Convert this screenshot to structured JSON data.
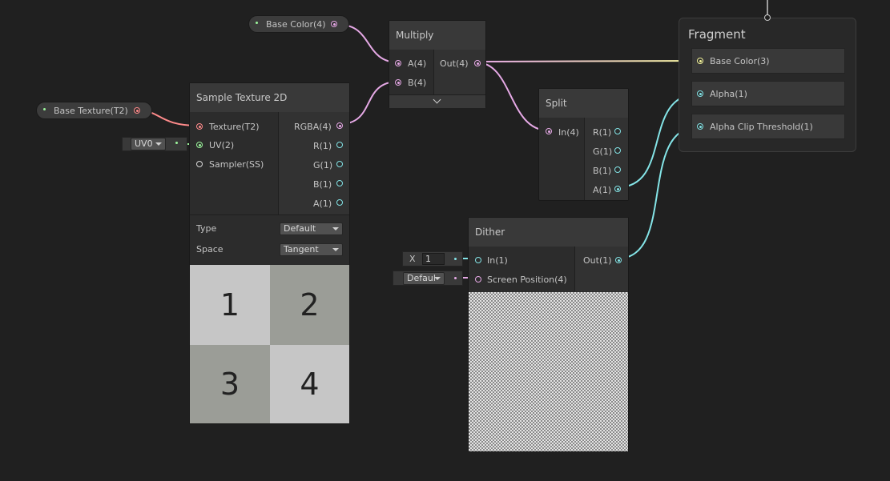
{
  "colors": {
    "background": "#202020",
    "node_body": "#2c2c2c",
    "node_title": "#393939",
    "vector4_port": "#e6a9e6",
    "vector3_port": "#f5f59c",
    "vector1_port": "#84e4e7",
    "vector2_port": "#9cf59c",
    "texture_port": "#ff8b8b",
    "sampler_port": "#d8d8d8"
  },
  "base_color_property": {
    "label": "Base Color(4)"
  },
  "base_texture_property": {
    "label": "Base Texture(T2)"
  },
  "uv_dropdown": {
    "value": "UV0"
  },
  "sample_texture_node": {
    "title": "Sample Texture 2D",
    "inputs": [
      "Texture(T2)",
      "UV(2)",
      "Sampler(SS)"
    ],
    "outputs": [
      "RGBA(4)",
      "R(1)",
      "G(1)",
      "B(1)",
      "A(1)"
    ],
    "type_label": "Type",
    "type_value": "Default",
    "space_label": "Space",
    "space_value": "Tangent",
    "preview_cells": [
      "1",
      "2",
      "3",
      "4"
    ]
  },
  "multiply_node": {
    "title": "Multiply",
    "inputs": [
      "A(4)",
      "B(4)"
    ],
    "outputs": [
      "Out(4)"
    ]
  },
  "split_node": {
    "title": "Split",
    "inputs": [
      "In(4)"
    ],
    "outputs": [
      "R(1)",
      "G(1)",
      "B(1)",
      "A(1)"
    ]
  },
  "dither_node": {
    "title": "Dither",
    "inputs": [
      "In(1)",
      "Screen Position(4)"
    ],
    "outputs": [
      "Out(1)"
    ],
    "x_label": "X",
    "x_value": "1",
    "screen_position_mode": "Defaul"
  },
  "fragment_block": {
    "title": "Fragment",
    "slots": [
      "Base Color(3)",
      "Alpha(1)",
      "Alpha Clip Threshold(1)"
    ]
  }
}
